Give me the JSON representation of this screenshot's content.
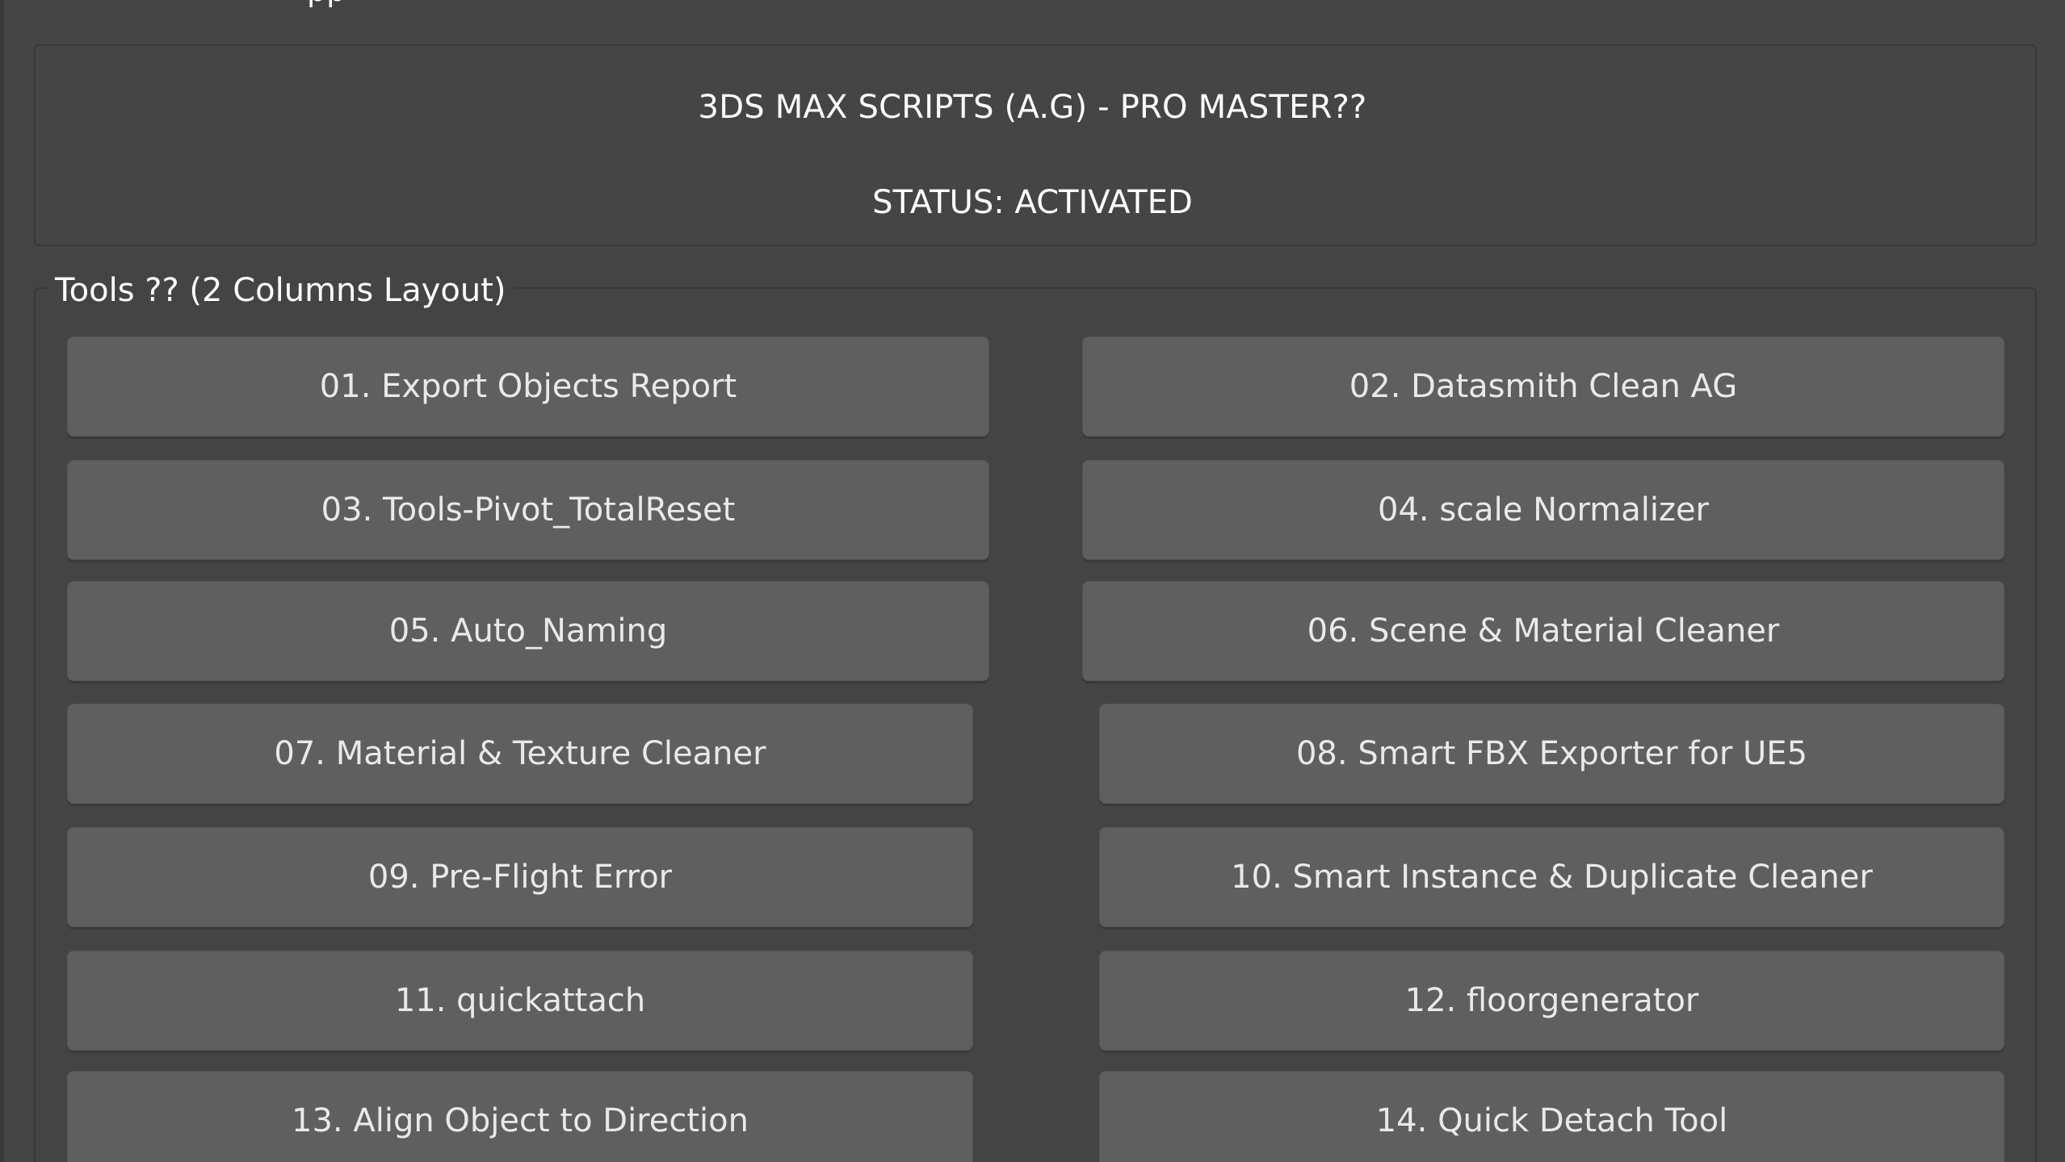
{
  "window": {
    "title": "pp"
  },
  "header": {
    "title": "3DS MAX SCRIPTS (A.G) - PRO MASTER??",
    "status": "STATUS: ACTIVATED"
  },
  "tools": {
    "group_label": "Tools ?? (2 Columns Layout)",
    "buttons": [
      "01. Export Objects Report",
      "02. Datasmith Clean AG",
      "03. Tools-Pivot_TotalReset",
      "04. scale Normalizer",
      "05. Auto_Naming",
      "06. Scene & Material Cleaner",
      "07. Material & Texture Cleaner",
      "08. Smart FBX Exporter for UE5",
      "09. Pre-Flight Error",
      "10. Smart Instance & Duplicate Cleaner",
      "11. quickattach",
      "12. floorgenerator",
      "13. Align Object to Direction",
      "14. Quick Detach Tool"
    ]
  },
  "colors": {
    "background": "#444444",
    "button": "#5f5f5f",
    "text": "#ffffff",
    "button_text": "#e9e9e9"
  }
}
